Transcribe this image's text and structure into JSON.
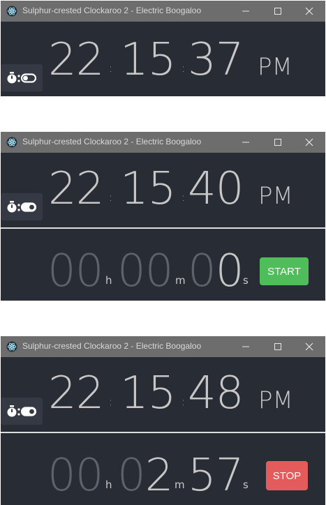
{
  "windows": [
    {
      "title": "Sulphur-crested Clockaroo 2 - Electric Boogaloo",
      "clock": {
        "hours": "22",
        "minutes": "15",
        "seconds": "37",
        "ampm": "PM",
        "colon": ":"
      }
    },
    {
      "title": "Sulphur-crested Clockaroo 2 - Electric Boogaloo",
      "clock": {
        "hours": "22",
        "minutes": "15",
        "seconds": "40",
        "ampm": "PM",
        "colon": ":"
      },
      "stopwatch": {
        "h_dim": "00",
        "h_lit": "",
        "h_unit": "h",
        "m_dim": "00",
        "m_lit": "",
        "m_unit": "m",
        "s_dim": "0",
        "s_lit": "0",
        "s_unit": "s",
        "button_label": "START"
      }
    },
    {
      "title": "Sulphur-crested Clockaroo 2 - Electric Boogaloo",
      "clock": {
        "hours": "22",
        "minutes": "15",
        "seconds": "48",
        "ampm": "PM",
        "colon": ":"
      },
      "stopwatch": {
        "h_dim": "00",
        "h_lit": "",
        "h_unit": "h",
        "m_dim": "0",
        "m_lit": "2",
        "m_unit": "m",
        "s_dim": "",
        "s_lit": "57",
        "s_unit": "s",
        "button_label": "STOP"
      }
    }
  ],
  "icons": {
    "app": "electron-atom-icon",
    "minimize": "minimize-icon",
    "maximize": "maximize-icon",
    "close": "close-icon",
    "stopwatch": "stopwatch-icon",
    "toggle": "toggle-switch-icon"
  },
  "colors": {
    "titlebar": "#6d6d6d",
    "background": "#282c34",
    "digits": "#c7c7c7",
    "digits_dim": "#5e636b",
    "start_button": "#4fbd5a",
    "stop_button": "#e35b5a"
  }
}
